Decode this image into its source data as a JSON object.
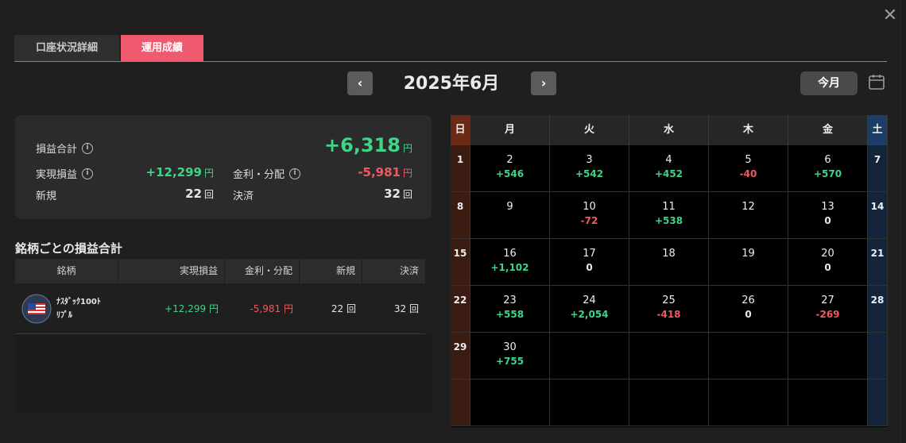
{
  "tabs": [
    {
      "label": "口座状況詳細",
      "active": false
    },
    {
      "label": "運用成績",
      "active": true
    }
  ],
  "nav": {
    "prev": "‹",
    "next": "›",
    "month": "2025年6月",
    "today": "今月"
  },
  "summary": {
    "total_label": "損益合計",
    "total_value": "+6,318",
    "realized_label": "実現損益",
    "realized_value": "+12,299",
    "interest_label": "金利・分配",
    "interest_value": "-5,981",
    "new_label": "新規",
    "new_value": "22",
    "settle_label": "決済",
    "settle_value": "32",
    "yen": "円",
    "count_unit": "回"
  },
  "issues": {
    "title": "銘柄ごとの損益合計",
    "headers": [
      "銘柄",
      "実現損益",
      "金利・分配",
      "新規",
      "決済"
    ],
    "row": {
      "name_line1": "ﾅｽﾀﾞｯｸ100ﾄ",
      "name_line2": "ﾘﾌﾟﾙ",
      "realized": "+12,299",
      "interest": "-5,981",
      "new": "22",
      "settle": "32"
    }
  },
  "calendar": {
    "weekdays": [
      "日",
      "月",
      "火",
      "水",
      "木",
      "金",
      "土"
    ],
    "weeks": [
      [
        {
          "d": "1"
        },
        {
          "d": "2",
          "v": "+546",
          "c": "green"
        },
        {
          "d": "3",
          "v": "+542",
          "c": "green"
        },
        {
          "d": "4",
          "v": "+452",
          "c": "green"
        },
        {
          "d": "5",
          "v": "-40",
          "c": "red"
        },
        {
          "d": "6",
          "v": "+570",
          "c": "green"
        },
        {
          "d": "7"
        }
      ],
      [
        {
          "d": "8"
        },
        {
          "d": "9"
        },
        {
          "d": "10",
          "v": "-72",
          "c": "red"
        },
        {
          "d": "11",
          "v": "+538",
          "c": "green"
        },
        {
          "d": "12"
        },
        {
          "d": "13",
          "v": "0",
          "c": "white"
        },
        {
          "d": "14"
        }
      ],
      [
        {
          "d": "15"
        },
        {
          "d": "16",
          "v": "+1,102",
          "c": "green"
        },
        {
          "d": "17",
          "v": "0",
          "c": "white"
        },
        {
          "d": "18"
        },
        {
          "d": "19"
        },
        {
          "d": "20",
          "v": "0",
          "c": "white"
        },
        {
          "d": "21"
        }
      ],
      [
        {
          "d": "22"
        },
        {
          "d": "23",
          "v": "+558",
          "c": "green"
        },
        {
          "d": "24",
          "v": "+2,054",
          "c": "green"
        },
        {
          "d": "25",
          "v": "-418",
          "c": "red"
        },
        {
          "d": "26",
          "v": "0",
          "c": "white"
        },
        {
          "d": "27",
          "v": "-269",
          "c": "red"
        },
        {
          "d": "28"
        }
      ],
      [
        {
          "d": "29"
        },
        {
          "d": "30",
          "v": "+755",
          "c": "green"
        },
        {
          "d": ""
        },
        {
          "d": ""
        },
        {
          "d": ""
        },
        {
          "d": ""
        },
        {
          "d": ""
        }
      ],
      [
        {
          "d": ""
        },
        {
          "d": ""
        },
        {
          "d": ""
        },
        {
          "d": ""
        },
        {
          "d": ""
        },
        {
          "d": ""
        },
        {
          "d": ""
        }
      ]
    ]
  },
  "colors": {
    "accent": "#ef5a6e",
    "profit": "#3fd487",
    "loss": "#f05a62"
  }
}
